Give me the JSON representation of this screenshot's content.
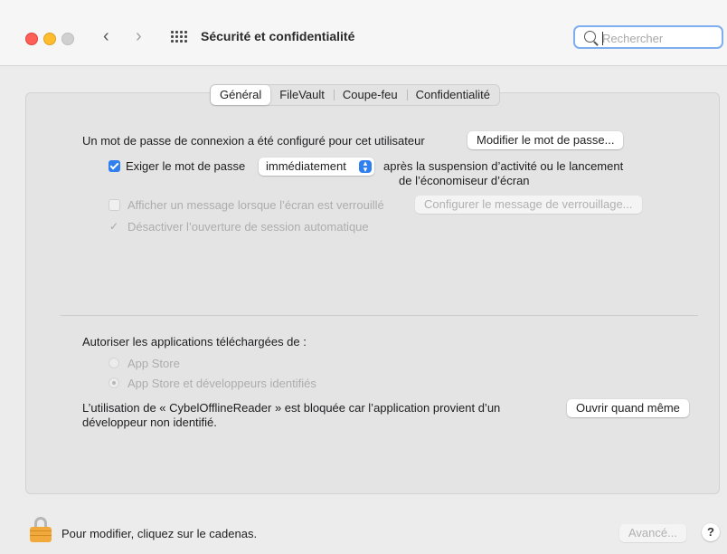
{
  "window": {
    "title": "Sécurité et confidentialité"
  },
  "search": {
    "placeholder": "Rechercher"
  },
  "tabs": [
    {
      "label": "Général",
      "active": true
    },
    {
      "label": "FileVault",
      "active": false
    },
    {
      "label": "Coupe-feu",
      "active": false
    },
    {
      "label": "Confidentialité",
      "active": false
    }
  ],
  "general": {
    "password_text": "Un mot de passe de connexion a été configuré pour cet utilisateur",
    "change_password_button": "Modifier le mot de passe...",
    "require_password": {
      "label": "Exiger le mot de passe",
      "checked": true,
      "selected_option": "immédiatement",
      "suffix_line1": "après la suspension d’activité ou le lancement",
      "suffix_line2": "de l’économiseur d’écran"
    },
    "show_message": {
      "label": "Afficher un message lorsque l’écran est verrouillé",
      "checked": false,
      "enabled": false,
      "button": "Configurer le message de verrouillage..."
    },
    "disable_auto_login": {
      "label": "Désactiver l’ouverture de session automatique",
      "checked": true,
      "enabled": false
    },
    "allow_apps_heading": "Autoriser les applications téléchargées de :",
    "radio_options": [
      {
        "label": "App Store",
        "selected": false
      },
      {
        "label": "App Store et développeurs identifiés",
        "selected": true
      }
    ],
    "blocked_line1": "L’utilisation de « CybelOfflineReader » est bloquée car l’application provient d’un",
    "blocked_line2": "développeur non identifié.",
    "open_anyway_button": "Ouvrir quand même"
  },
  "footer": {
    "lock_text": "Pour modifier, cliquez sur le cadenas.",
    "advanced_button": "Avancé...",
    "help_button": "?"
  },
  "colors": {
    "accent": "#2f7ff0",
    "lock": "#f1a93c"
  }
}
